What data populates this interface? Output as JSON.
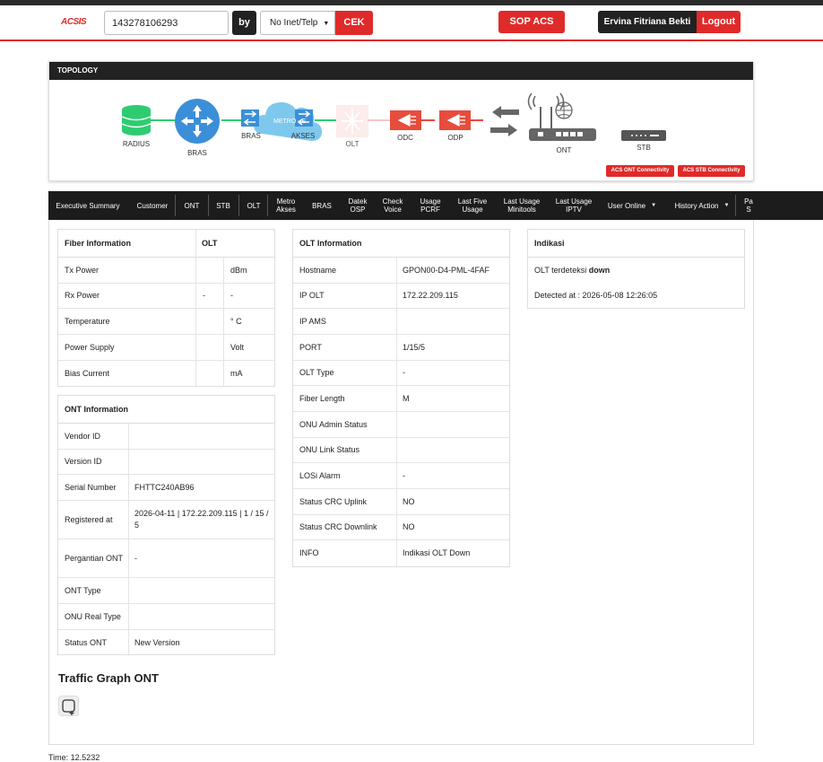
{
  "header": {
    "logo": "ACSIS",
    "search_value": "143278106293",
    "by_label": "by",
    "select_value": "No Inet/Telp",
    "check_button": "CEK",
    "sop_button": "SOP ACS",
    "user_name": "Ervina Fitriana Bekti",
    "logout_button": "Logout"
  },
  "topology": {
    "title": "TOPOLOGY",
    "nodes": {
      "radius": "RADIUS",
      "bras1": "BRAS",
      "bras2": "BRAS",
      "metro": "METRO - E",
      "akses": "AKSES",
      "olt": "OLT",
      "odc": "ODC",
      "odp": "ODP",
      "ont": "ONT",
      "stb": "STB"
    },
    "acs_ont_button": "ACS ONT Connectivity",
    "acs_stb_button": "ACS STB Connectivity",
    "colors": {
      "ok": "#2ecc71",
      "down": "#e74c3c",
      "bras": "#3498db",
      "radius": "#2ecc71"
    }
  },
  "nav": {
    "items": [
      "Executive Summary",
      "Customer",
      "ONT",
      "STB",
      "OLT",
      "Metro Akses",
      "BRAS",
      "Datek OSP",
      "Check Voice",
      "Usage PCRF",
      "Last Five Usage",
      "Last Usage Minitools",
      "Last Usage IPTV",
      "User Online",
      "History Action",
      "Pa S"
    ]
  },
  "fiber": {
    "title": "Fiber Information",
    "olt_header": "OLT",
    "rows": [
      {
        "label": "Tx Power",
        "value": "",
        "unit": "dBm"
      },
      {
        "label": "Rx Power",
        "value": "-",
        "unit": "-"
      },
      {
        "label": "Temperature",
        "value": "",
        "unit": "° C"
      },
      {
        "label": "Power Supply",
        "value": "",
        "unit": "Volt"
      },
      {
        "label": "Bias Current",
        "value": "",
        "unit": "mA"
      }
    ]
  },
  "ont": {
    "title": "ONT Information",
    "rows": [
      {
        "label": "Vendor ID",
        "value": ""
      },
      {
        "label": "Version ID",
        "value": ""
      },
      {
        "label": "Serial Number",
        "value": "FHTTC240AB96"
      },
      {
        "label": "Registered at",
        "value": "2026-04-11 | 172.22.209.115 | 1 / 15 / 5"
      },
      {
        "label": "Pergantian ONT",
        "value": "-"
      },
      {
        "label": "ONT Type",
        "value": ""
      },
      {
        "label": "ONU Real Type",
        "value": ""
      },
      {
        "label": "Status ONT",
        "value": "New Version"
      }
    ]
  },
  "olt": {
    "title": "OLT Information",
    "rows": [
      {
        "label": "Hostname",
        "value": "GPON00-D4-PML-4FAF"
      },
      {
        "label": "IP OLT",
        "value": "172.22.209.115"
      },
      {
        "label": "IP AMS",
        "value": ""
      },
      {
        "label": "PORT",
        "value": "1/15/5"
      },
      {
        "label": "OLT Type",
        "value": "-"
      },
      {
        "label": "Fiber Length",
        "value": "M"
      },
      {
        "label": "ONU Admin Status",
        "value": ""
      },
      {
        "label": "ONU Link Status",
        "value": ""
      },
      {
        "label": "LOSi Alarm",
        "value": "-"
      },
      {
        "label": "Status CRC Uplink",
        "value": "NO"
      },
      {
        "label": "Status CRC Downlink",
        "value": "NO"
      },
      {
        "label": "INFO",
        "value": "Indikasi OLT Down"
      }
    ]
  },
  "indikasi": {
    "title": "Indikasi",
    "text_prefix": "OLT terdeteksi",
    "text_status": "down",
    "detected_label": "Detected at : 2026-05-08 12:26:05"
  },
  "traffic": {
    "title": "Traffic Graph ONT"
  },
  "footer": {
    "time": "Time: 12.5232"
  }
}
